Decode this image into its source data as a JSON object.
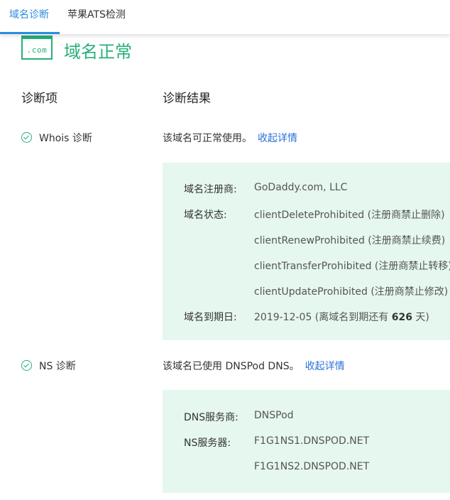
{
  "tabs": [
    {
      "label": "域名诊断",
      "active": true
    },
    {
      "label": "苹果ATS检测",
      "active": false
    }
  ],
  "status": {
    "icon_text": ".com",
    "text": "域名正常"
  },
  "columns": {
    "item": "诊断项",
    "result": "诊断结果"
  },
  "whois": {
    "label": "Whois 诊断",
    "summary": "该域名可正常使用。",
    "link": "收起详情",
    "registrar_label": "域名注册商:",
    "registrar": "GoDaddy.com, LLC",
    "status_label": "域名状态:",
    "statuses": [
      "clientDeleteProhibited (注册商禁止删除)",
      "clientRenewProhibited (注册商禁止续费)",
      "clientTransferProhibited (注册商禁止转移)",
      "clientUpdateProhibited (注册商禁止修改)"
    ],
    "expiry_label": "域名到期日:",
    "expiry_prefix": "2019-12-05 (离域名到期还有",
    "expiry_days": "626",
    "expiry_suffix": "天)"
  },
  "ns": {
    "label": "NS 诊断",
    "summary": "该域名已使用 DNSPod DNS。",
    "link": "收起详情",
    "provider_label": "DNS服务商:",
    "provider": "DNSPod",
    "servers_label": "NS服务器:",
    "servers": [
      "F1G1NS1.DNSPOD.NET",
      "F1G1NS2.DNSPOD.NET"
    ]
  },
  "colors": {
    "accent": "#2a8ce0",
    "ok": "#25b077",
    "link": "#2a72d8",
    "detail_bg": "#e5f7ef"
  }
}
